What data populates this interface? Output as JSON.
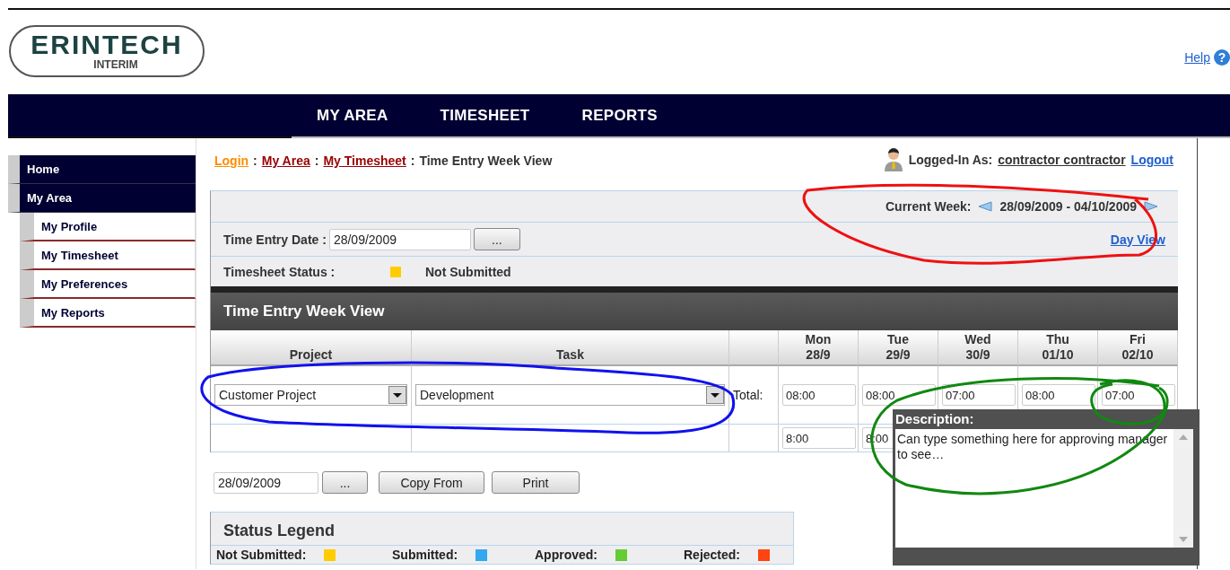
{
  "header": {
    "logo": {
      "wordmark": "ERINTECH",
      "subtitle": "INTERIM"
    },
    "help": {
      "label": "Help",
      "icon": "?"
    }
  },
  "nav": [
    {
      "label": "MY AREA"
    },
    {
      "label": "TIMESHEET"
    },
    {
      "label": "REPORTS"
    }
  ],
  "sidebar": [
    {
      "label": "Home"
    },
    {
      "label": "My Area",
      "children": [
        {
          "label": "My Profile"
        },
        {
          "label": "My Timesheet"
        },
        {
          "label": "My Preferences"
        },
        {
          "label": "My Reports"
        }
      ]
    }
  ],
  "breadcrumb": {
    "separator": ":",
    "items": [
      {
        "label": "Login",
        "kind": "visited"
      },
      {
        "label": "My Area",
        "kind": "link"
      },
      {
        "label": "My Timesheet",
        "kind": "link"
      },
      {
        "label": "Time Entry Week View",
        "kind": "current"
      }
    ]
  },
  "user": {
    "label": "Logged-In As:",
    "name": "contractor contractor",
    "logout": "Logout"
  },
  "week": {
    "label": "Current Week:",
    "range": "28/09/2009 - 04/10/2009",
    "day_view": "Day View"
  },
  "entry_date": {
    "label": "Time Entry Date :",
    "value": "28/09/2009",
    "picker": "..."
  },
  "status": {
    "label": "Timesheet Status :",
    "color": "#ffcc00",
    "value": "Not Submitted"
  },
  "week_view": {
    "title": "Time Entry Week View",
    "project_header": "Project",
    "task_header": "Task",
    "days": [
      {
        "day": "Mon",
        "date": "28/9"
      },
      {
        "day": "Tue",
        "date": "29/9"
      },
      {
        "day": "Wed",
        "date": "30/9"
      },
      {
        "day": "Thu",
        "date": "01/10"
      },
      {
        "day": "Fri",
        "date": "02/10"
      }
    ],
    "rows": [
      {
        "kind": "entry",
        "project": "Customer Project",
        "task": "Development",
        "total_label": "Total:",
        "hours": [
          "08:00",
          "08:00",
          "07:00",
          "08:00",
          "07:00"
        ]
      },
      {
        "kind": "totals",
        "hours": [
          "8:00",
          "8:00"
        ]
      }
    ]
  },
  "copy_controls": {
    "date": "28/09/2009",
    "picker": "...",
    "buttons": [
      "Copy From",
      "Print"
    ]
  },
  "status_legend": {
    "title": "Status Legend",
    "items": [
      {
        "label": "Not Submitted:",
        "color": "#ffcc00"
      },
      {
        "label": "Submitted:",
        "color": "#33a8f0"
      },
      {
        "label": "Approved:",
        "color": "#66cc33"
      },
      {
        "label": "Rejected:",
        "color": "#ff4411"
      }
    ]
  },
  "description_popup": {
    "title": "Description:",
    "text": "Can type something here for approving manager to see…"
  }
}
